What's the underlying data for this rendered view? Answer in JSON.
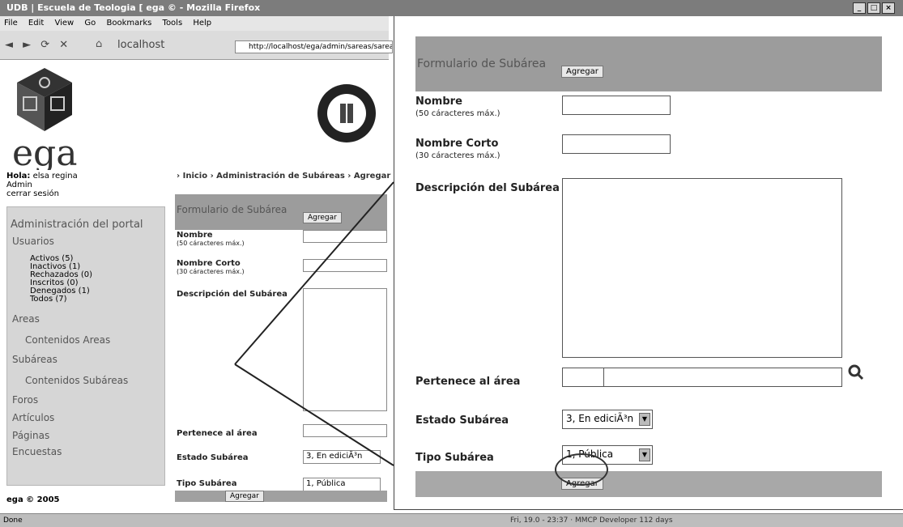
{
  "window": {
    "title": "UDB | Escuela de Teologia [ ega © - Mozilla Firefox",
    "controls": [
      "_",
      "□",
      "×"
    ]
  },
  "menu": [
    "File",
    "Edit",
    "View",
    "Go",
    "Bookmarks",
    "Tools",
    "Help"
  ],
  "toolbar": {
    "nav_icons": "◄ ► ⟳ ✕",
    "home_icon": "⌂",
    "host": "localhost",
    "url": "http://localhost/ega/admin/sareas/sarea"
  },
  "logo": {
    "text": "ega",
    "icon": "cube-logo-icon"
  },
  "seal": {
    "icon": "university-seal-icon"
  },
  "user": {
    "greeting_label": "Hola:",
    "name": "elsa regina",
    "role": "Admin",
    "logout": "cerrar sesión"
  },
  "breadcrumb": "› Inicio › Administración de Subáreas › Agregar",
  "sidebar": {
    "title": "Administración del portal",
    "users_label": "Usuarios",
    "user_counts": [
      "Activos (5)",
      "Inactivos (1)",
      "Rechazados (0)",
      "Inscritos (0)",
      "Denegados (1)",
      "Todos (7)"
    ],
    "items": [
      "Areas",
      "Contenidos Areas",
      "Subáreas",
      "Contenidos Subáreas",
      "Foros",
      "Artículos",
      "Páginas",
      "Encuestas"
    ]
  },
  "footer": "ega © 2005",
  "form": {
    "title": "Formulario de Subárea",
    "add_button": "Agregar",
    "name_label": "Nombre",
    "name_hint": "(50 cáracteres máx.)",
    "short_name_label": "Nombre Corto",
    "short_name_hint": "(30 cáracteres máx.)",
    "description_label": "Descripción del Subárea",
    "area_label": "Pertenece al área",
    "status_label": "Estado Subárea",
    "status_value": "3, En ediciÃ³n",
    "type_label": "Tipo Subárea",
    "type_value": "1, Pública",
    "submit_button": "Agregar"
  },
  "status_bar": {
    "left": "Done",
    "right": "Fri, 19.0 - 23:37 · MMCP Developer 112 days"
  },
  "colors": {
    "form_header": "#9c9c9c",
    "sidebar_bg": "#d6d6d6",
    "titlebar": "#7c7c7c"
  }
}
